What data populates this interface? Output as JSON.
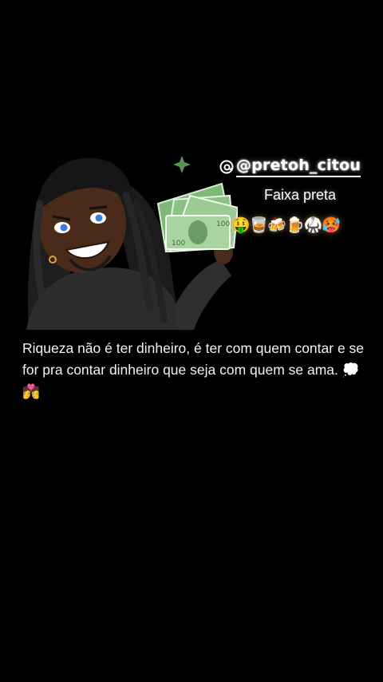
{
  "post": {
    "handle": "@pretoh_citou",
    "subtitle": "Faixa preta",
    "emoji_strip": "🤑🥃🍻🍺🥋🥵",
    "caption": "Riqueza não é ter dinheiro, é ter com quem contar e se for pra contar dinheiro que seja com quem se ama. 💭💏"
  },
  "icons": {
    "handle_icon": "threads-icon",
    "sticker": "avatar-holding-cash-sticker"
  },
  "colors": {
    "background": "#000000",
    "text": "#ffffff",
    "cash_green": "#6fae6a"
  }
}
